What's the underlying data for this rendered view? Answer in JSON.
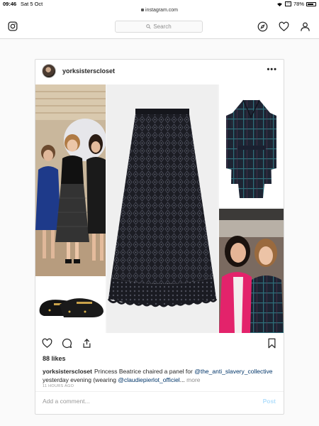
{
  "status_bar": {
    "time": "09:46",
    "date": "Sat 5 Oct",
    "url": "instagram.com",
    "battery": "78%",
    "battery_level": 0.78
  },
  "topbar": {
    "search_placeholder": "Search"
  },
  "post": {
    "username": "yorksisterscloset",
    "likes": "88 likes",
    "caption": {
      "user": "yorksisterscloset",
      "text_1": "Princess Beatrice chaired a panel for ",
      "mention_1": "@the_anti_slavery_collective",
      "text_2": " yesterday evening (wearing ",
      "mention_2": "@claudiepierlot_officiel",
      "ellipsis": "...",
      "more": " more"
    },
    "time_ago": "11 HOURS AGO",
    "comment_placeholder": "Add a comment...",
    "post_button": "Post"
  },
  "icons": {
    "instagram": "instagram-logo-icon",
    "search": "search-icon",
    "explore": "compass-icon",
    "activity": "heart-icon",
    "profile": "person-icon",
    "like": "heart-icon",
    "comment": "comment-icon",
    "share": "share-icon",
    "save": "bookmark-icon"
  }
}
